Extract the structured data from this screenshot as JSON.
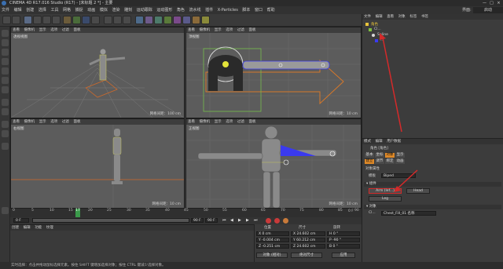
{
  "window": {
    "title": "CINEMA 4D R17.016 Studio (R17) - [未标题 2 *] - 主要",
    "right_buttons": [
      "—",
      "□",
      "×"
    ]
  },
  "menubar": [
    "文件",
    "编辑",
    "创建",
    "选择",
    "工具",
    "网格",
    "捕捉",
    "动画",
    "模拟",
    "渲染",
    "雕刻",
    "运动跟踪",
    "运动图形",
    "角色",
    "流水线",
    "插件",
    "X-Particles",
    "脚本",
    "窗口",
    "帮助"
  ],
  "layout_label": "界面:",
  "layout_value": "启动",
  "viewports": {
    "menu": [
      "查看",
      "摄像机",
      "显示",
      "选项",
      "过滤",
      "面板"
    ],
    "top_left": {
      "name": "透视视图",
      "dist": "网格间距：100 cm"
    },
    "top_right": {
      "name": "顶视图",
      "dist": "网格间距：10 cm"
    },
    "bottom_left": {
      "name": "右视图",
      "dist": "网格间距：10 cm"
    },
    "bottom_right": {
      "name": "正视图",
      "dist": "网格间距：10 cm"
    }
  },
  "timeline": {
    "ticks": [
      "0",
      "5",
      "10",
      "15",
      "20",
      "25",
      "30",
      "35",
      "40",
      "45",
      "50",
      "55",
      "60",
      "65",
      "70",
      "75",
      "80",
      "85",
      "90"
    ],
    "current": "17",
    "start": "0 F",
    "field_mid": "0 F",
    "end": "90 F",
    "end2": "90 F",
    "frame_display": "0 F"
  },
  "material_menu": [
    "创建",
    "编辑",
    "功能",
    "纹理"
  ],
  "coords": {
    "headers": [
      "位置",
      "尺寸",
      "旋转"
    ],
    "rows": [
      {
        "pos": "X  0 cm",
        "size": "X  24.602 cm",
        "rot": "H  0 °"
      },
      {
        "pos": "Y  -0.004 cm",
        "size": "Y  60.212 cm",
        "rot": "P  -90 °"
      },
      {
        "pos": "Z  -0.251 cm",
        "size": "Z  24.602 cm",
        "rot": "B  0 °"
      }
    ],
    "mode": "对象 (相对)",
    "size_mode": "绝对尺寸",
    "apply": "应用"
  },
  "status_text": "实时选择：点击并拖动鼠标选择元素。按住 SHIFT 键增加选择对象；按住 CTRL 键减少选择对象。",
  "object_manager": {
    "menu": [
      "文件",
      "编辑",
      "查看",
      "对象",
      "标签",
      "书签"
    ],
    "objects": [
      {
        "name": "角色",
        "color": "#e8c33a"
      },
      {
        "name": "Cl...",
        "color": "#7fbf3f"
      },
      {
        "name": "Spline",
        "color": "#d8d8d8"
      },
      {
        "name": "..",
        "color": "#d8d8d8"
      }
    ]
  },
  "attribute_manager": {
    "menu": [
      "模式",
      "编辑",
      "用户数据"
    ],
    "object_title": "角色 [角色]",
    "tabs": [
      "基本",
      "坐标",
      "对象",
      "显示"
    ],
    "active_tab": "对象",
    "sub_tabs": [
      "建立",
      "调节",
      "绑定",
      "动画"
    ],
    "section_title": "对象属性",
    "template_label": "模板",
    "template_value": "Biped",
    "components_header": "▾ 组件",
    "btn_arm": "Arm (lef...)",
    "btn_head": "Head",
    "btn_leg": "Leg",
    "objects_header": "▾ 对象",
    "object_row_label": "Cl...",
    "object_row_value": "Chest_Fill_01 名称"
  },
  "colors": {
    "accent": "#e08a28",
    "viewport_bg": "#5c5c5c",
    "red_arrow": "#d42a2a",
    "selection_blue": "#3a3aee"
  }
}
